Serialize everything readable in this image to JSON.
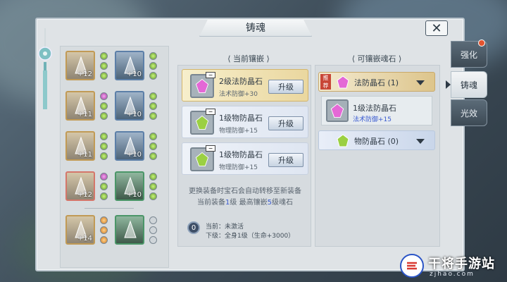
{
  "window": {
    "title": "铸魂",
    "close_icon": "✕"
  },
  "side_tabs": [
    {
      "label": "强化",
      "has_notice": true
    },
    {
      "label": "铸魂",
      "active": true
    },
    {
      "label": "光效"
    }
  ],
  "equipment": [
    {
      "slot": "helmet",
      "level": "+12",
      "frame": "gold"
    },
    {
      "slot": "necklace",
      "level": "+10",
      "frame": "blue"
    },
    {
      "slot": "bracer",
      "level": "+11",
      "frame": "gold"
    },
    {
      "slot": "pendant",
      "level": "+10",
      "frame": "blue"
    },
    {
      "slot": "chest",
      "level": "+11",
      "frame": "gold"
    },
    {
      "slot": "ring",
      "level": "+10",
      "frame": "blue"
    },
    {
      "slot": "boots",
      "level": "+12",
      "frame": "gold",
      "selected": true
    },
    {
      "slot": "charm",
      "level": "+10",
      "frame": "green"
    },
    {
      "slot": "weapon",
      "level": "+14",
      "frame": "gold"
    },
    {
      "slot": "fashion",
      "level": "",
      "frame": "green"
    }
  ],
  "current": {
    "header": "当前镶嵌",
    "gems": [
      {
        "name": "2级法防晶石",
        "stat": "法术防御+30",
        "button": "升级",
        "active": true
      },
      {
        "name": "1级物防晶石",
        "stat": "物理防御+15",
        "button": "升级"
      },
      {
        "name": "1级物防晶石",
        "stat": "物理防御+15",
        "button": "升级"
      }
    ],
    "note_line1": "更换装备时宝石会自动转移至新装备",
    "note_line2_a": "当前装备",
    "note_line2_b": "1",
    "note_line2_c": "级 最高镶嵌",
    "note_line2_d": "5",
    "note_line2_e": "级魂石",
    "status_icon_value": "0",
    "status_current": "当前：未激活",
    "status_next": "下级：全身1级（生命+3000）"
  },
  "available": {
    "header": "可镶嵌魂石",
    "recommend_tag": "推荐",
    "categories": [
      {
        "name": "法防晶石 (1)",
        "open": true
      },
      {
        "name": "物防晶石 (0)"
      }
    ],
    "items": [
      {
        "name": "1级法防晶石",
        "stat": "法术防御+15"
      }
    ]
  },
  "watermark": {
    "text": "干将手游站",
    "sub": "zjhao.com"
  },
  "colors": {
    "accent_blue": "#3a5bd0",
    "notice_red": "#e4542f",
    "recommend_red": "#c84637"
  }
}
